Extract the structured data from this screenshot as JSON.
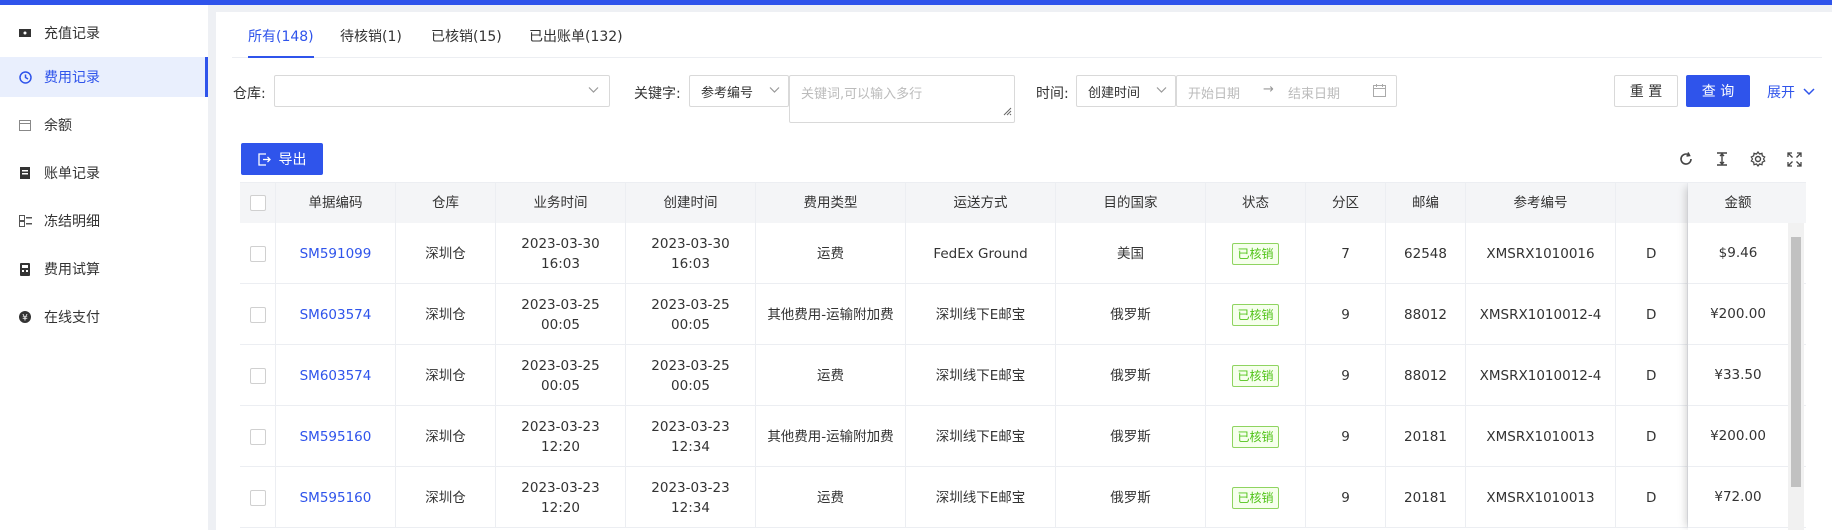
{
  "sidebar": {
    "items": [
      {
        "label": "充值记录",
        "icon": "ticket-icon",
        "active": false
      },
      {
        "label": "费用记录",
        "icon": "clock-icon",
        "active": true
      },
      {
        "label": "余额",
        "icon": "calendar-icon",
        "active": false
      },
      {
        "label": "账单记录",
        "icon": "document-icon",
        "active": false
      },
      {
        "label": "冻结明细",
        "icon": "list-icon",
        "active": false
      },
      {
        "label": "费用试算",
        "icon": "calculator-icon",
        "active": false
      },
      {
        "label": "在线支付",
        "icon": "yuan-icon",
        "active": false
      }
    ]
  },
  "tabs": [
    {
      "label": "所有(148)",
      "active": true
    },
    {
      "label": "待核销(1)",
      "active": false
    },
    {
      "label": "已核销(15)",
      "active": false
    },
    {
      "label": "已出账单(132)",
      "active": false
    }
  ],
  "filters": {
    "warehouse_label": "仓库:",
    "warehouse_value": "",
    "keyword_label": "关键字:",
    "keyword_type": "参考编号",
    "keyword_placeholder": "关键词,可以输入多行",
    "time_label": "时间:",
    "time_type": "创建时间",
    "start_placeholder": "开始日期",
    "end_placeholder": "结束日期",
    "range_arrow": "→",
    "reset_label": "重 置",
    "search_label": "查 询",
    "expand_label": "展开"
  },
  "toolbar": {
    "export_label": "导出"
  },
  "table": {
    "headers": [
      "单据编码",
      "仓库",
      "业务时间",
      "创建时间",
      "费用类型",
      "运送方式",
      "目的国家",
      "状态",
      "分区",
      "邮编",
      "参考编号",
      "金额"
    ],
    "rows": [
      {
        "code": "SM591099",
        "warehouse": "深圳仓",
        "biz_date": "2023-03-30",
        "biz_time": "16:03",
        "create_date": "2023-03-30",
        "create_time": "16:03",
        "fee_type": "运费",
        "shipping": "FedEx Ground",
        "country": "美国",
        "status": "已核销",
        "zone": "7",
        "zip": "62548",
        "ref": "XMSRX1010016",
        "extra": "D",
        "amount": "$9.46"
      },
      {
        "code": "SM603574",
        "warehouse": "深圳仓",
        "biz_date": "2023-03-25",
        "biz_time": "00:05",
        "create_date": "2023-03-25",
        "create_time": "00:05",
        "fee_type": "其他费用-运输附加费",
        "shipping": "深圳线下E邮宝",
        "country": "俄罗斯",
        "status": "已核销",
        "zone": "9",
        "zip": "88012",
        "ref": "XMSRX1010012-4",
        "extra": "D",
        "amount": "¥200.00"
      },
      {
        "code": "SM603574",
        "warehouse": "深圳仓",
        "biz_date": "2023-03-25",
        "biz_time": "00:05",
        "create_date": "2023-03-25",
        "create_time": "00:05",
        "fee_type": "运费",
        "shipping": "深圳线下E邮宝",
        "country": "俄罗斯",
        "status": "已核销",
        "zone": "9",
        "zip": "88012",
        "ref": "XMSRX1010012-4",
        "extra": "D",
        "amount": "¥33.50"
      },
      {
        "code": "SM595160",
        "warehouse": "深圳仓",
        "biz_date": "2023-03-23",
        "biz_time": "12:20",
        "create_date": "2023-03-23",
        "create_time": "12:34",
        "fee_type": "其他费用-运输附加费",
        "shipping": "深圳线下E邮宝",
        "country": "俄罗斯",
        "status": "已核销",
        "zone": "9",
        "zip": "20181",
        "ref": "XMSRX1010013",
        "extra": "D",
        "amount": "¥200.00"
      },
      {
        "code": "SM595160",
        "warehouse": "深圳仓",
        "biz_date": "2023-03-23",
        "biz_time": "12:20",
        "create_date": "2023-03-23",
        "create_time": "12:34",
        "fee_type": "运费",
        "shipping": "深圳线下E邮宝",
        "country": "俄罗斯",
        "status": "已核销",
        "zone": "9",
        "zip": "20181",
        "ref": "XMSRX1010013",
        "extra": "D",
        "amount": "¥72.00"
      }
    ]
  },
  "colors": {
    "accent": "#2f54eb",
    "success": "#52c41a"
  }
}
